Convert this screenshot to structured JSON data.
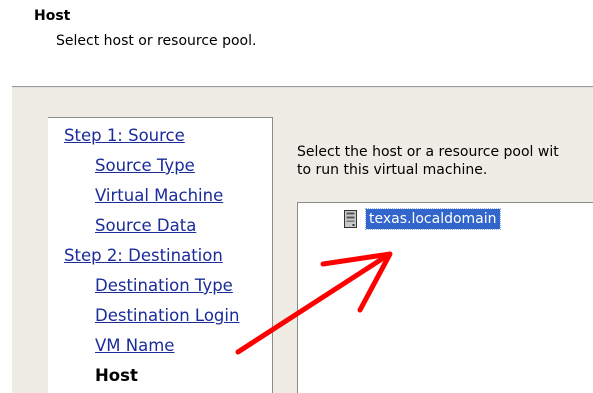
{
  "header": {
    "title": "Host",
    "subtitle": "Select host or resource pool."
  },
  "nav": {
    "items": [
      {
        "label": "Step 1: Source",
        "kind": "step"
      },
      {
        "label": "Source Type",
        "kind": "sub"
      },
      {
        "label": "Virtual Machine",
        "kind": "sub"
      },
      {
        "label": "Source Data",
        "kind": "sub"
      },
      {
        "label": "Step 2: Destination",
        "kind": "step"
      },
      {
        "label": "Destination Type",
        "kind": "sub"
      },
      {
        "label": "Destination Login",
        "kind": "sub"
      },
      {
        "label": "VM Name",
        "kind": "sub"
      },
      {
        "label": "Host",
        "kind": "current"
      }
    ]
  },
  "main": {
    "instruction_line1": "Select the host or a resource pool wit",
    "instruction_line2": "to run this virtual machine.",
    "tree": {
      "selected_host": "texas.localdomain",
      "icon": "server-icon"
    }
  },
  "colors": {
    "link": "#1a2b9a",
    "selection": "#3366cc",
    "panel": "#eeece4",
    "arrow": "#ff0000"
  }
}
